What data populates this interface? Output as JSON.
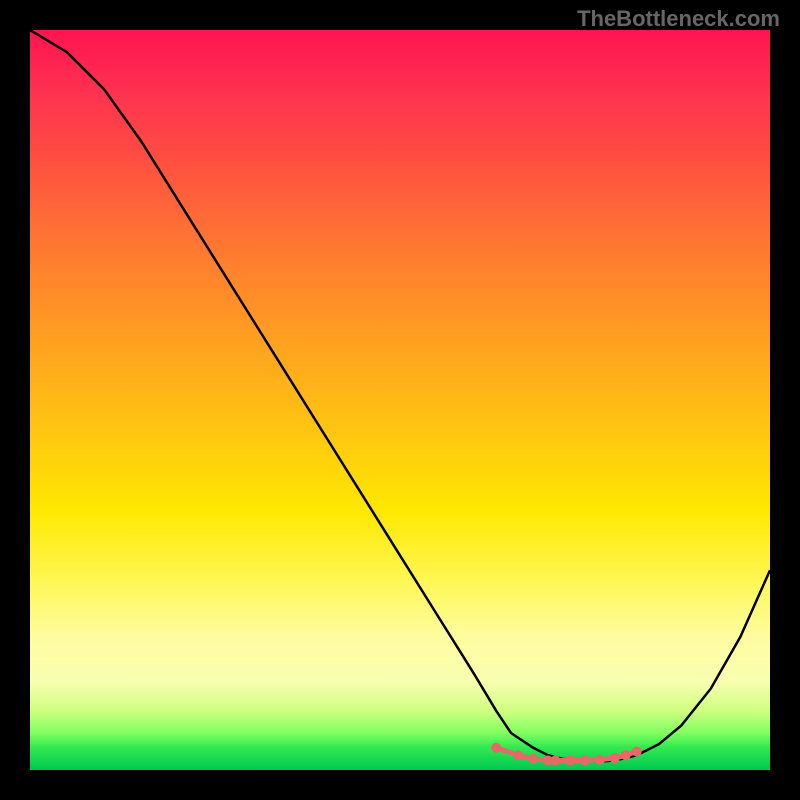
{
  "attribution": "TheBottleneck.com",
  "chart_data": {
    "type": "line",
    "title": "",
    "xlabel": "",
    "ylabel": "",
    "xlim": [
      0,
      100
    ],
    "ylim": [
      0,
      100
    ],
    "series": [
      {
        "name": "curve",
        "x": [
          0,
          5,
          10,
          15,
          20,
          25,
          30,
          35,
          40,
          45,
          50,
          55,
          60,
          63,
          65,
          68,
          70,
          72,
          75,
          78,
          80,
          82,
          85,
          88,
          92,
          96,
          100
        ],
        "y": [
          100,
          97,
          92,
          85,
          77,
          69,
          61,
          53,
          45,
          37,
          29,
          21,
          13,
          8,
          5,
          3,
          2,
          1.5,
          1.2,
          1.2,
          1.5,
          2,
          3.5,
          6,
          11,
          18,
          27
        ]
      },
      {
        "name": "bottom-markers",
        "x": [
          63,
          66,
          68,
          70,
          71,
          73,
          75,
          77,
          79,
          80.5,
          82
        ],
        "y": [
          3,
          2,
          1.5,
          1.3,
          1.3,
          1.3,
          1.3,
          1.4,
          1.6,
          2,
          2.5
        ]
      }
    ]
  }
}
